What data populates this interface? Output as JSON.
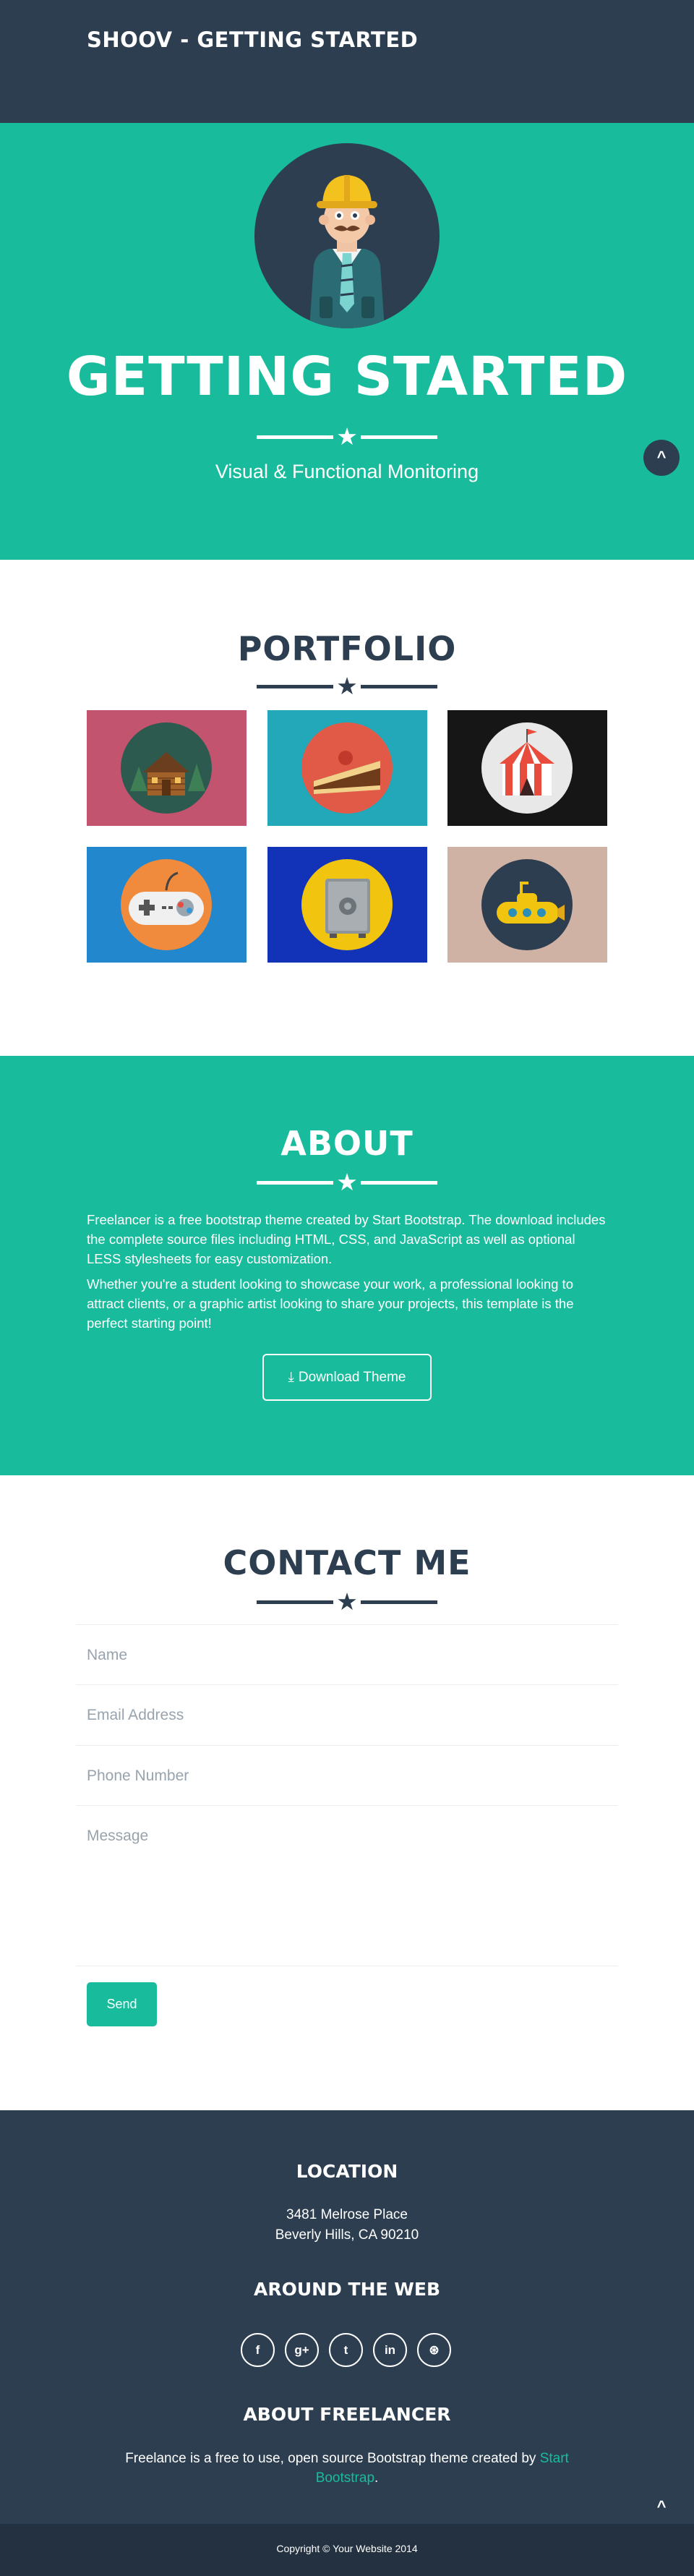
{
  "nav": {
    "brand": "SHOOV - GETTING STARTED"
  },
  "hero": {
    "title": "GETTING STARTED",
    "subtitle": "Visual & Functional Monitoring",
    "star": "★",
    "scroll_icon": "^"
  },
  "portfolio": {
    "title": "PORTFOLIO",
    "star": "★",
    "items": [
      {
        "name": "cabin",
        "bg": "#c2546f"
      },
      {
        "name": "cake",
        "bg": "#22a8b8"
      },
      {
        "name": "circus",
        "bg": "#161616"
      },
      {
        "name": "game",
        "bg": "#2287cc"
      },
      {
        "name": "safe",
        "bg": "#1232b8"
      },
      {
        "name": "submarine",
        "bg": "#d0b2a4"
      }
    ]
  },
  "about": {
    "title": "ABOUT",
    "star": "★",
    "p1": "Freelancer is a free bootstrap theme created by Start Bootstrap. The download includes the complete source files including HTML, CSS, and JavaScript as well as optional LESS stylesheets for easy customization.",
    "p2": "Whether you're a student looking to showcase your work, a professional looking to attract clients, or a graphic artist looking to share your projects, this template is the perfect starting point!",
    "download_icon": "⤓",
    "download_label": "Download Theme"
  },
  "contact": {
    "title": "CONTACT ME",
    "star": "★",
    "name_placeholder": "Name",
    "email_placeholder": "Email Address",
    "phone_placeholder": "Phone Number",
    "message_placeholder": "Message",
    "send_label": "Send"
  },
  "footer": {
    "location_title": "LOCATION",
    "address_line1": "3481 Melrose Place",
    "address_line2": "Beverly Hills, CA 90210",
    "web_title": "AROUND THE WEB",
    "social": [
      {
        "name": "facebook",
        "glyph": "f"
      },
      {
        "name": "google-plus",
        "glyph": "g+"
      },
      {
        "name": "twitter",
        "glyph": "t"
      },
      {
        "name": "linkedin",
        "glyph": "in"
      },
      {
        "name": "dribbble",
        "glyph": "⊛"
      }
    ],
    "about_title": "ABOUT FREELANCER",
    "about_text": "Freelance is a free to use, open source Bootstrap theme created by",
    "about_link": "Start Bootstrap",
    "about_end": ".",
    "scroll_icon": "^",
    "copyright": "Copyright © Your Website 2014"
  },
  "colors": {
    "primary": "#2c3e50",
    "accent": "#18bc9c",
    "footer_bottom": "#233140"
  }
}
